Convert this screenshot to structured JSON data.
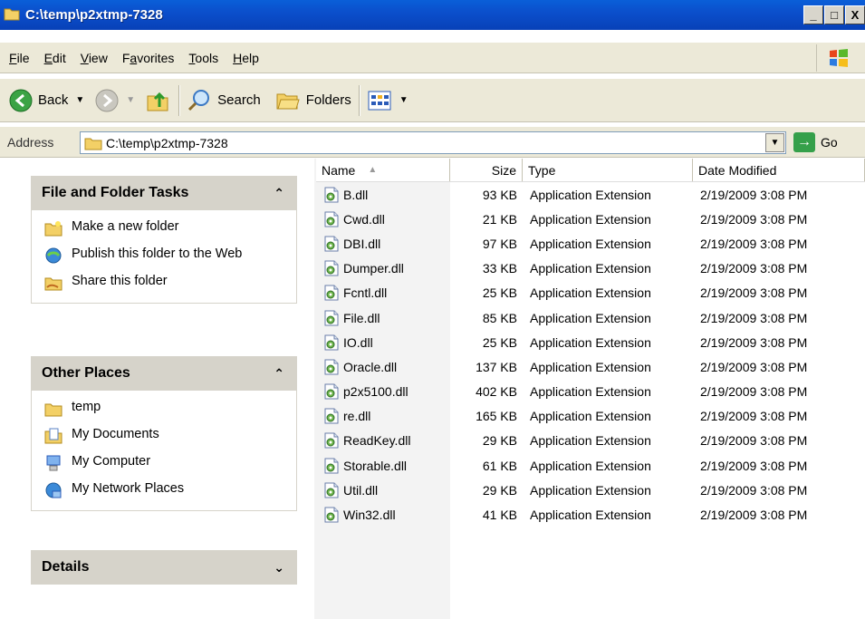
{
  "window": {
    "title": "C:\\temp\\p2xtmp-7328",
    "controls": [
      "_",
      "□",
      "X"
    ]
  },
  "menu": [
    {
      "label": "File",
      "key": "F"
    },
    {
      "label": "Edit",
      "key": "E"
    },
    {
      "label": "View",
      "key": "V"
    },
    {
      "label": "Favorites",
      "key": "a"
    },
    {
      "label": "Tools",
      "key": "T"
    },
    {
      "label": "Help",
      "key": "H"
    }
  ],
  "toolbar": {
    "back": "Back",
    "search": "Search",
    "folders": "Folders"
  },
  "address": {
    "label": "Address",
    "path": "C:\\temp\\p2xtmp-7328",
    "go": "Go"
  },
  "tasks_panel": {
    "title": "File and Folder Tasks",
    "items": [
      "Make a new folder",
      "Publish this folder to the Web",
      "Share this folder"
    ]
  },
  "places_panel": {
    "title": "Other Places",
    "items": [
      "temp",
      "My Documents",
      "My Computer",
      "My Network Places"
    ]
  },
  "details_panel": {
    "title": "Details"
  },
  "columns": {
    "name": "Name",
    "size": "Size",
    "type": "Type",
    "date": "Date Modified"
  },
  "files": [
    {
      "name": "B.dll",
      "size": "93 KB",
      "type": "Application Extension",
      "date": "2/19/2009 3:08 PM"
    },
    {
      "name": "Cwd.dll",
      "size": "21 KB",
      "type": "Application Extension",
      "date": "2/19/2009 3:08 PM"
    },
    {
      "name": "DBI.dll",
      "size": "97 KB",
      "type": "Application Extension",
      "date": "2/19/2009 3:08 PM"
    },
    {
      "name": "Dumper.dll",
      "size": "33 KB",
      "type": "Application Extension",
      "date": "2/19/2009 3:08 PM"
    },
    {
      "name": "Fcntl.dll",
      "size": "25 KB",
      "type": "Application Extension",
      "date": "2/19/2009 3:08 PM"
    },
    {
      "name": "File.dll",
      "size": "85 KB",
      "type": "Application Extension",
      "date": "2/19/2009 3:08 PM"
    },
    {
      "name": "IO.dll",
      "size": "25 KB",
      "type": "Application Extension",
      "date": "2/19/2009 3:08 PM"
    },
    {
      "name": "Oracle.dll",
      "size": "137 KB",
      "type": "Application Extension",
      "date": "2/19/2009 3:08 PM"
    },
    {
      "name": "p2x5100.dll",
      "size": "402 KB",
      "type": "Application Extension",
      "date": "2/19/2009 3:08 PM"
    },
    {
      "name": "re.dll",
      "size": "165 KB",
      "type": "Application Extension",
      "date": "2/19/2009 3:08 PM"
    },
    {
      "name": "ReadKey.dll",
      "size": "29 KB",
      "type": "Application Extension",
      "date": "2/19/2009 3:08 PM"
    },
    {
      "name": "Storable.dll",
      "size": "61 KB",
      "type": "Application Extension",
      "date": "2/19/2009 3:08 PM"
    },
    {
      "name": "Util.dll",
      "size": "29 KB",
      "type": "Application Extension",
      "date": "2/19/2009 3:08 PM"
    },
    {
      "name": "Win32.dll",
      "size": "41 KB",
      "type": "Application Extension",
      "date": "2/19/2009 3:08 PM"
    }
  ]
}
